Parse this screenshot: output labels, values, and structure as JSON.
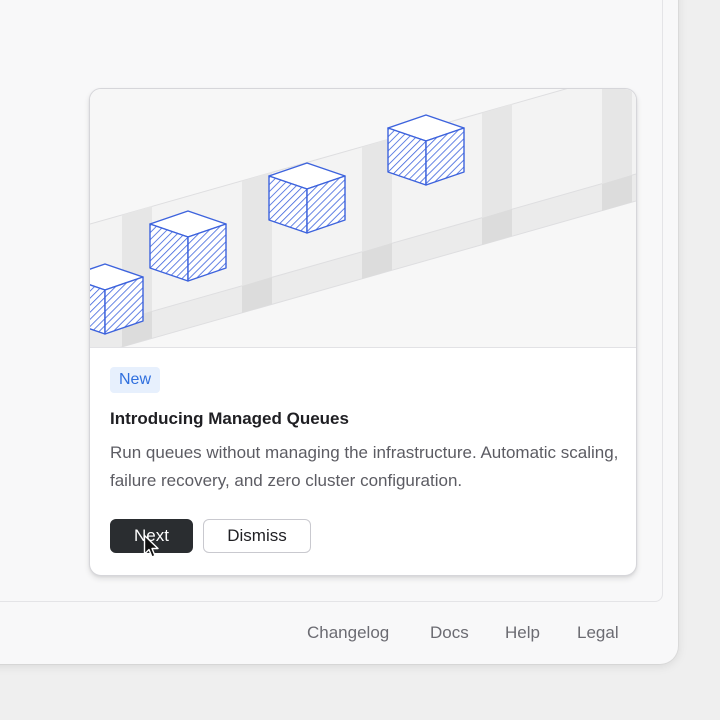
{
  "announcement": {
    "badge": "New",
    "title": "Introducing Managed Queues",
    "description": "Run queues without managing the infrastructure. Automatic scaling, failure recovery, and zero cluster configuration.",
    "buttons": {
      "next": "Next",
      "dismiss": "Dismiss"
    },
    "illustration": {
      "icons": [
        "queue-item-cube-icon",
        "queue-item-cube-icon",
        "queue-item-cube-icon",
        "queue-item-cube-icon"
      ],
      "accent": "#3d63dd"
    }
  },
  "footer": {
    "links": [
      "Changelog",
      "Docs",
      "Help",
      "Legal"
    ]
  },
  "colors": {
    "primary_button": "#2a2d30",
    "badge_bg": "#e7f0fd",
    "badge_text": "#2f6fde"
  }
}
